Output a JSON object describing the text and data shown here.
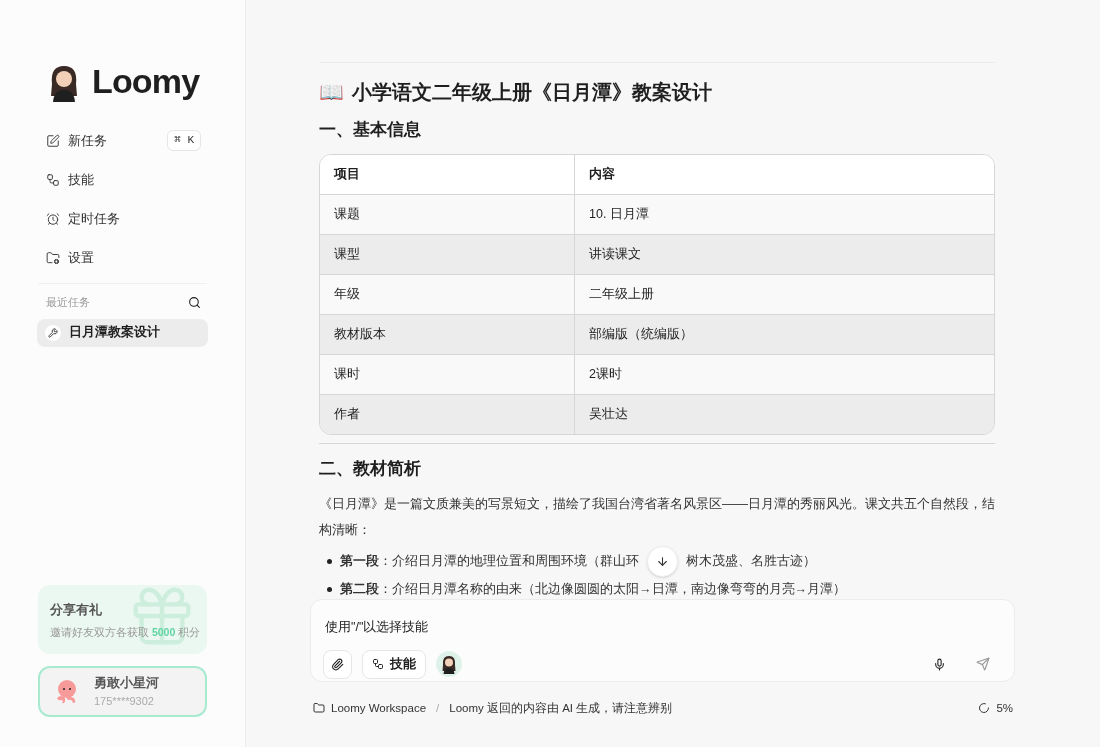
{
  "sidebar": {
    "brand": "Loomy",
    "menu": [
      {
        "label": "新任务",
        "shortcut": "⌘ K"
      },
      {
        "label": "技能"
      },
      {
        "label": "定时任务"
      },
      {
        "label": "设置"
      }
    ],
    "recent": {
      "title": "最近任务",
      "items": [
        {
          "label": "日月潭教案设计",
          "selected": true
        }
      ]
    },
    "promo": {
      "title": "分享有礼",
      "text_before": "邀请好友双方各获取",
      "highlight": "5000",
      "text_after": "积分"
    },
    "user": {
      "name": "勇敢小星河",
      "phone": "175****9302"
    }
  },
  "document": {
    "emoji": "📖",
    "title": "小学语文二年级上册《日月潭》教案设计",
    "sections": [
      {
        "heading": "一、基本信息",
        "table": {
          "columns": [
            "项目",
            "内容"
          ],
          "rows": [
            [
              "课题",
              "10. 日月潭"
            ],
            [
              "课型",
              "讲读课文"
            ],
            [
              "年级",
              "二年级上册"
            ],
            [
              "教材版本",
              "部编版（统编版）"
            ],
            [
              "课时",
              "2课时"
            ],
            [
              "作者",
              "吴壮达"
            ]
          ]
        }
      },
      {
        "heading": "二、教材简析",
        "paragraph": "《日月潭》是一篇文质兼美的写景短文，描绘了我国台湾省著名风景区——日月潭的秀丽风光。课文共五个自然段，结构清晰：",
        "bullets": [
          {
            "lead": "第一段",
            "text": "：介绍日月潭的地理位置和周围环境（群山环",
            "text_after": "树木茂盛、名胜古迹）"
          },
          {
            "lead": "第二段",
            "text": "：介绍日月潭名称的由来（北边像圆圆的太阳→日潭，南边像弯弯的月亮→月潭）"
          }
        ]
      }
    ]
  },
  "composer": {
    "placeholder": "使用\"/\"以选择技能",
    "skill_button": "技能"
  },
  "footer": {
    "workspace": "Loomy Workspace",
    "separator": "/",
    "notice": "Loomy 返回的内容由 AI 生成，请注意辨别",
    "progress": "5%"
  }
}
